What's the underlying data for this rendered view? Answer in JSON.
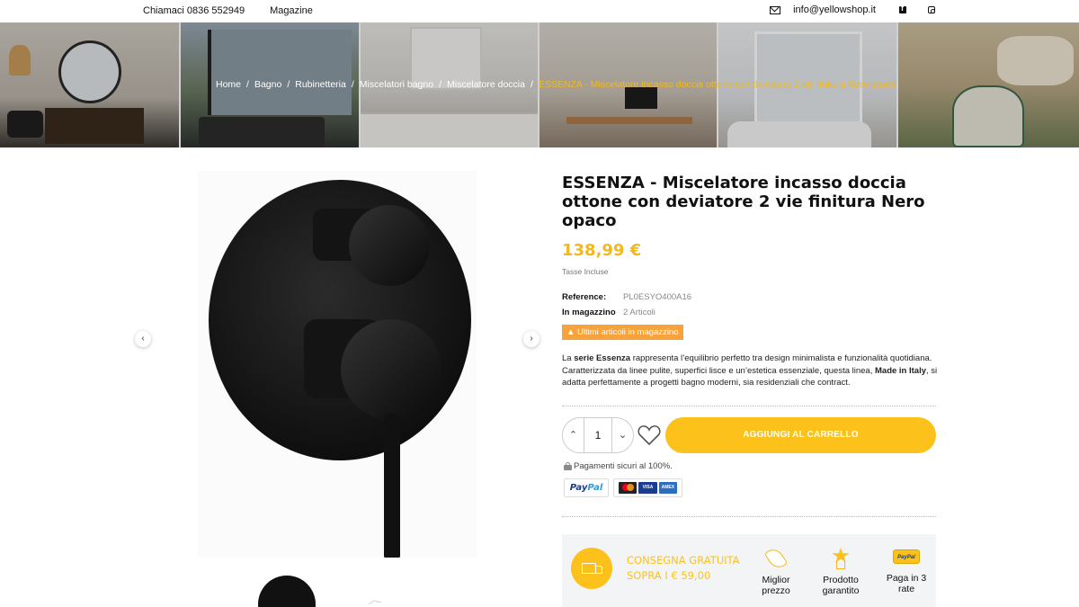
{
  "topbar": {
    "phone": "Chiamaci 0836 552949",
    "magazine": "Magazine",
    "email": "info@yellowshop.it",
    "icons": [
      "mail-icon",
      "facebook-icon",
      "instagram-icon"
    ]
  },
  "breadcrumb": [
    "Home",
    "Bagno",
    "Rubinetteria",
    "Miscelatori bagno",
    "Miscelatore doccia",
    "ESSENZA - Miscelatore incasso doccia ottone con deviatore 2 vie finitura Nero opaco"
  ],
  "product": {
    "title": "ESSENZA - Miscelatore incasso doccia ottone con deviatore 2 vie finitura Nero opaco",
    "price": "138,99 €",
    "taxes": "Tasse Incluse",
    "reference_label": "Reference:",
    "reference_value": "PL0ESYO400A16",
    "stock_label": "In magazzino",
    "stock_value": "2 Articoli",
    "low_stock": "Ultimi articoli in magazzino",
    "description": {
      "p1": "La ",
      "b1": "serie Essenza",
      "p2": " rappresenta l’equilibrio perfetto tra design minimalista e funzionalità quotidiana. Caratterizzata da linee pulite, superfici lisce e un’estetica essenziale, questa linea, ",
      "b2": "Made in Italy",
      "p3": ", si adatta perfettamente a progetti bagno moderni, sia residenziali che contract."
    },
    "quantity": "1",
    "add_to_cart": "AGGIUNGI AL CARRELLO",
    "secure_payments": "Pagamenti sicuri al 100%.",
    "payment_methods": [
      "PayPal",
      "Mastercard",
      "VISA",
      "AMEX"
    ]
  },
  "delivery": {
    "line1": "CONSEGNA GRATUITA",
    "line2": "SOPRA I € 59,00"
  },
  "features": [
    {
      "line1": "Miglior",
      "line2": "prezzo",
      "icon": "price-tag-icon"
    },
    {
      "line1": "Prodotto",
      "line2": "garantito",
      "icon": "medal-icon"
    },
    {
      "line1": "Paga in 3",
      "line2": "rate",
      "icon": "paypal-badge-icon"
    }
  ],
  "colors": {
    "accent": "#fcc21b",
    "price": "#f5b81b",
    "low_stock": "#f7a23a",
    "delivery_bg": "#f3f4f5"
  }
}
